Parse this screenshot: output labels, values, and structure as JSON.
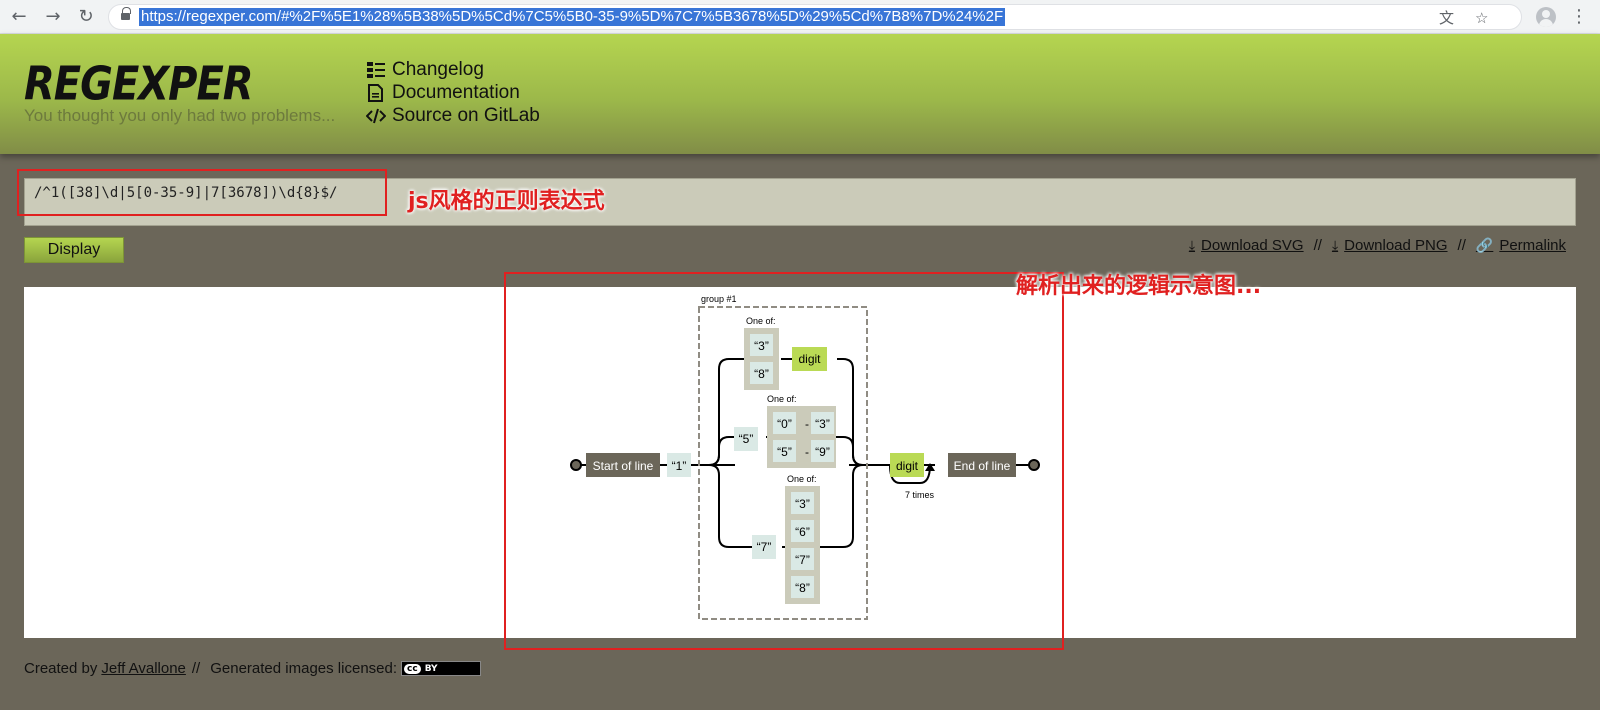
{
  "browser": {
    "url": "https://regexper.com/#%2F%5E1%28%5B38%5D%5Cd%7C5%5B0-35-9%5D%7C7%5B3678%5D%29%5Cd%7B8%7D%24%2F"
  },
  "header": {
    "logo": "REGEXPER",
    "tagline": "You thought you only had two problems...",
    "links": {
      "changelog": "Changelog",
      "documentation": "Documentation",
      "source": "Source on GitLab"
    }
  },
  "input": {
    "value": "/^1([38]\\d|5[0-35-9]|7[3678])\\d{8}$/"
  },
  "annotations": {
    "regex_note": "js风格的正则表达式",
    "diagram_note": "解析出来的逻辑示意图..."
  },
  "controls": {
    "display_label": "Display",
    "download_svg": "Download SVG",
    "download_png": "Download PNG",
    "permalink": "Permalink",
    "separator": "//"
  },
  "diagram": {
    "start": "Start of line",
    "end": "End of line",
    "group_label": "group #1",
    "one_of": "One of:",
    "literal_1": "“1”",
    "literal_3": "“3”",
    "literal_8": "“8”",
    "literal_5": "“5”",
    "literal_0": "“0”",
    "literal_9": "“9”",
    "literal_7": "“7”",
    "literal_6": "“6”",
    "digit": "digit",
    "dash": "-",
    "repeat": "7 times"
  },
  "footer": {
    "created_by": "Created by",
    "author": "Jeff Avallone",
    "separator": "//",
    "licensed": "Generated images licensed:",
    "badge_cc": "cc",
    "badge_by": "BY"
  },
  "colors": {
    "accent_green": "#b5d550",
    "annotation_red": "#e02020",
    "box_dark": "#6b6659",
    "charset_bg": "#cbcbba",
    "literal_bg": "#dae9e5"
  }
}
